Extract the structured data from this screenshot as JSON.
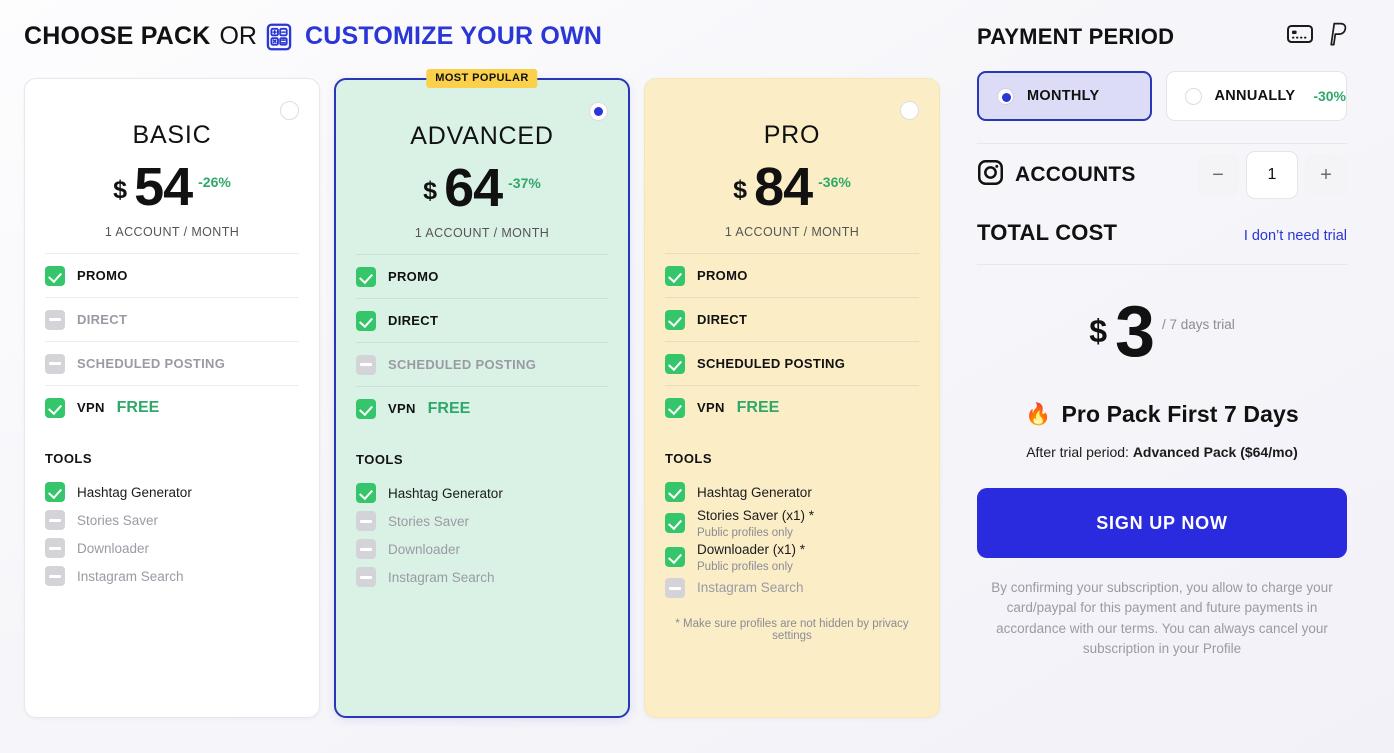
{
  "header": {
    "choose_pack": "CHOOSE PACK",
    "or": "OR",
    "customize": "CUSTOMIZE YOUR OWN",
    "calculator_icon": "calculator-icon"
  },
  "packs": [
    {
      "id": "basic",
      "name": "BASIC",
      "currency": "$",
      "price": "54",
      "discount": "-26%",
      "period": "1 ACCOUNT / MONTH",
      "selected": false,
      "badge": null,
      "features": [
        {
          "label": "PROMO",
          "included": true,
          "suffix": null
        },
        {
          "label": "DIRECT",
          "included": false,
          "suffix": null
        },
        {
          "label": "SCHEDULED POSTING",
          "included": false,
          "suffix": null
        },
        {
          "label": "VPN",
          "included": true,
          "suffix": "FREE"
        }
      ],
      "tools_heading": "TOOLS",
      "tools": [
        {
          "label": "Hashtag Generator",
          "included": true,
          "note": null
        },
        {
          "label": "Stories Saver",
          "included": false,
          "note": null
        },
        {
          "label": "Downloader",
          "included": false,
          "note": null
        },
        {
          "label": "Instagram Search",
          "included": false,
          "note": null
        }
      ],
      "footnote": null
    },
    {
      "id": "advanced",
      "name": "ADVANCED",
      "currency": "$",
      "price": "64",
      "discount": "-37%",
      "period": "1 ACCOUNT / MONTH",
      "selected": true,
      "badge": "MOST POPULAR",
      "features": [
        {
          "label": "PROMO",
          "included": true,
          "suffix": null
        },
        {
          "label": "DIRECT",
          "included": true,
          "suffix": null
        },
        {
          "label": "SCHEDULED POSTING",
          "included": false,
          "suffix": null
        },
        {
          "label": "VPN",
          "included": true,
          "suffix": "FREE"
        }
      ],
      "tools_heading": "TOOLS",
      "tools": [
        {
          "label": "Hashtag Generator",
          "included": true,
          "note": null
        },
        {
          "label": "Stories Saver",
          "included": false,
          "note": null
        },
        {
          "label": "Downloader",
          "included": false,
          "note": null
        },
        {
          "label": "Instagram Search",
          "included": false,
          "note": null
        }
      ],
      "footnote": null
    },
    {
      "id": "pro",
      "name": "PRO",
      "currency": "$",
      "price": "84",
      "discount": "-36%",
      "period": "1 ACCOUNT / MONTH",
      "selected": false,
      "badge": null,
      "features": [
        {
          "label": "PROMO",
          "included": true,
          "suffix": null
        },
        {
          "label": "DIRECT",
          "included": true,
          "suffix": null
        },
        {
          "label": "SCHEDULED POSTING",
          "included": true,
          "suffix": null
        },
        {
          "label": "VPN",
          "included": true,
          "suffix": "FREE"
        }
      ],
      "tools_heading": "TOOLS",
      "tools": [
        {
          "label": "Hashtag Generator",
          "included": true,
          "note": null
        },
        {
          "label": "Stories Saver (x1) *",
          "included": true,
          "note": "Public profiles only"
        },
        {
          "label": "Downloader (x1) *",
          "included": true,
          "note": "Public profiles only"
        },
        {
          "label": "Instagram Search",
          "included": false,
          "note": null
        }
      ],
      "footnote": "* Make sure profiles are not hidden by privacy settings"
    }
  ],
  "sidebar": {
    "payment_period_title": "PAYMENT PERIOD",
    "pay_icons": [
      "credit-card-icon",
      "paypal-icon"
    ],
    "periods": [
      {
        "label": "MONTHLY",
        "discount": null,
        "selected": true
      },
      {
        "label": "ANNUALLY",
        "discount": "-30%",
        "selected": false
      }
    ],
    "accounts": {
      "icon": "instagram-icon",
      "label": "ACCOUNTS",
      "minus": "−",
      "value": "1",
      "plus": "+"
    },
    "total_cost": {
      "title": "TOTAL COST",
      "skip_trial_link": "I don’t need trial",
      "currency": "$",
      "amount": "3",
      "unit": "/ 7 days trial",
      "plan_emoji": "🔥",
      "plan_title": "Pro Pack First 7 Days",
      "after_prefix": "After trial period: ",
      "after_plan": "Advanced Pack ($64/mo)"
    },
    "cta_label": "SIGN UP NOW",
    "terms": "By confirming your subscription, you allow to charge your card/paypal for this payment and future payments in accordance with our terms. You can always cancel your subscription in your Profile"
  },
  "colors": {
    "brand_blue": "#2a36d6",
    "cta_blue": "#2a2ade",
    "green": "#35c56a",
    "discount_green": "#2fa86a",
    "advanced_bg": "#daf2e6",
    "pro_bg": "#fbeec7",
    "badge_yellow": "#fbd04a"
  }
}
